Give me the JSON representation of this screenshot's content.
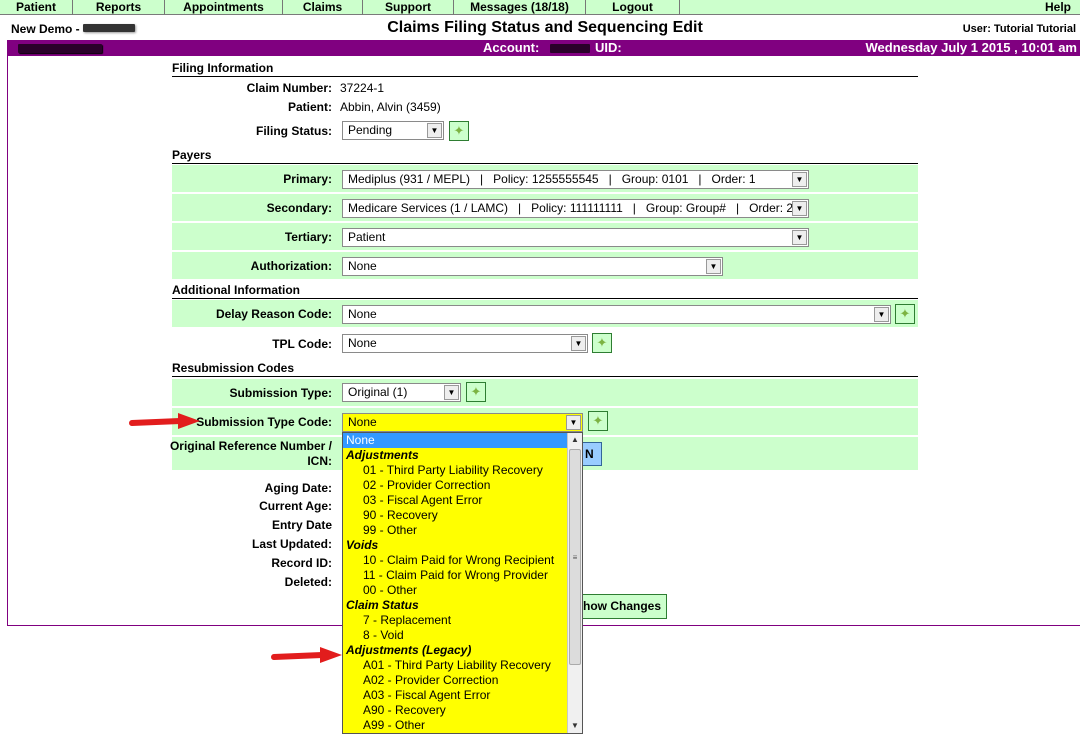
{
  "nav": [
    "Patient",
    "Reports",
    "Appointments",
    "Claims",
    "Support",
    "Messages (18/18)",
    "Logout",
    "Help"
  ],
  "header": {
    "demo": "New Demo -",
    "title": "Claims Filing Status and Sequencing Edit",
    "user": "User: Tutorial Tutorial"
  },
  "bar": {
    "account": "Account:",
    "uid": "UID:",
    "date": "Wednesday July 1 2015 , 10:01 am"
  },
  "filing": {
    "heading": "Filing Information",
    "claim_label": "Claim Number:",
    "claim_value": "37224-1",
    "patient_label": "Patient:",
    "patient_value": "Abbin, Alvin (3459)",
    "status_label": "Filing Status:",
    "status_value": "Pending"
  },
  "payers": {
    "heading": "Payers",
    "primary_label": "Primary:",
    "primary_value": "Mediplus (931 / MEPL)   |   Policy: 1255555545   |   Group: 0101   |   Order: 1",
    "secondary_label": "Secondary:",
    "secondary_value": "Medicare Services (1 / LAMC)   |   Policy: 111111111   |   Group: Group#   |   Order: 2",
    "tertiary_label": "Tertiary:",
    "tertiary_value": "Patient",
    "auth_label": "Authorization:",
    "auth_value": "None"
  },
  "additional": {
    "heading": "Additional Information",
    "delay_label": "Delay Reason Code:",
    "delay_value": "None",
    "tpl_label": "TPL Code:",
    "tpl_value": "None"
  },
  "resub": {
    "heading": "Resubmission Codes",
    "subtype_label": "Submission Type:",
    "subtype_value": "Original (1)",
    "subcode_label": "Submission Type Code:",
    "subcode_value": "None",
    "origref_label_1": "Original Reference Number /",
    "origref_label_2": "ICN:",
    "icn_button_text": "N"
  },
  "info": {
    "aging_label": "Aging Date:",
    "age_label": "Current Age:",
    "entry_label": "Entry Date",
    "updated_label": "Last Updated:",
    "record_label": "Record ID:",
    "deleted_label": "Deleted:"
  },
  "show_changes": "how Changes",
  "dropdown": {
    "items": [
      {
        "kind": "opt",
        "text": "None",
        "selected": true
      },
      {
        "kind": "grp",
        "text": "Adjustments"
      },
      {
        "kind": "opt",
        "text": "01 - Third Party Liability Recovery"
      },
      {
        "kind": "opt",
        "text": "02 - Provider Correction"
      },
      {
        "kind": "opt",
        "text": "03 - Fiscal Agent Error"
      },
      {
        "kind": "opt",
        "text": "90 - Recovery"
      },
      {
        "kind": "opt",
        "text": "99 - Other"
      },
      {
        "kind": "grp",
        "text": "Voids"
      },
      {
        "kind": "opt",
        "text": "10 - Claim Paid for Wrong Recipient"
      },
      {
        "kind": "opt",
        "text": "11 - Claim Paid for Wrong Provider"
      },
      {
        "kind": "opt",
        "text": "00 - Other"
      },
      {
        "kind": "grp",
        "text": "Claim Status"
      },
      {
        "kind": "opt",
        "text": "7 - Replacement"
      },
      {
        "kind": "opt",
        "text": "8 - Void"
      },
      {
        "kind": "grp",
        "text": "Adjustments (Legacy)"
      },
      {
        "kind": "opt",
        "text": "A01 - Third Party Liability Recovery"
      },
      {
        "kind": "opt",
        "text": "A02 - Provider Correction"
      },
      {
        "kind": "opt",
        "text": "A03 - Fiscal Agent Error"
      },
      {
        "kind": "opt",
        "text": "A90 - Recovery"
      },
      {
        "kind": "opt",
        "text": "A99 - Other"
      }
    ]
  },
  "colors": {
    "nav_bg": "#ccffcc",
    "accent_purple": "#800080",
    "row_green": "#ccffcc",
    "dropdown_yellow": "#ffff00",
    "selected_blue": "#3399ff",
    "arrow_red": "#e21d1d"
  }
}
